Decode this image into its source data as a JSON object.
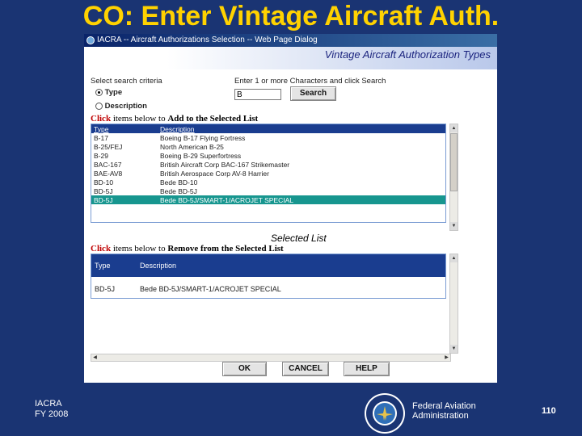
{
  "slide": {
    "title": "CO: Enter Vintage Aircraft Auth."
  },
  "dialog": {
    "window_title": "IACRA -- Aircraft Authorizations Selection -- Web Page Dialog",
    "header_title": "Vintage Aircraft Authorization Types",
    "search": {
      "criteria_label": "Select search criteria",
      "instructions": "Enter 1 or more Characters and click Search",
      "option_type": "Type",
      "option_description": "Description",
      "input_value": "B",
      "button_label": "Search"
    },
    "add_instruction": {
      "click": "Click",
      "mid": " items below to ",
      "action": "Add to the Selected List"
    },
    "available_list": {
      "columns": [
        "Type",
        "Description"
      ],
      "rows": [
        {
          "type": "B-17",
          "description": "Boeing B-17 Flying Fortress"
        },
        {
          "type": "B-25/FEJ",
          "description": "North American B-25"
        },
        {
          "type": "B-29",
          "description": "Boeing B-29 Superfortress"
        },
        {
          "type": "BAC-167",
          "description": "British Aircraft Corp BAC-167 Strikemaster"
        },
        {
          "type": "BAE-AV8",
          "description": "British Aerospace Corp AV-8 Harrier"
        },
        {
          "type": "BD-10",
          "description": "Bede BD-10"
        },
        {
          "type": "BD-5J",
          "description": "Bede BD-5J"
        },
        {
          "type": "BD-5J",
          "description": "Bede BD-5J/SMART-1/ACROJET SPECIAL"
        }
      ]
    },
    "selected_list_label": "Selected List",
    "remove_instruction": {
      "click": "Click",
      "mid": " items below to ",
      "action": "Remove from the Selected List"
    },
    "selected_list": {
      "columns": [
        "Type",
        "Description"
      ],
      "rows": [
        {
          "type": "BD-5J",
          "description": "Bede BD-5J/SMART-1/ACROJET SPECIAL"
        }
      ]
    },
    "buttons": {
      "ok": "OK",
      "cancel": "CANCEL",
      "help": "HELP"
    }
  },
  "footer": {
    "left_line1": "IACRA",
    "left_line2": "FY 2008",
    "agency_line1": "Federal Aviation",
    "agency_line2": "Administration",
    "page_number": "110"
  },
  "colors": {
    "background": "#1a3473",
    "title": "#ffd200",
    "list_header": "#1a3d8f",
    "list_selected": "#17968f"
  }
}
